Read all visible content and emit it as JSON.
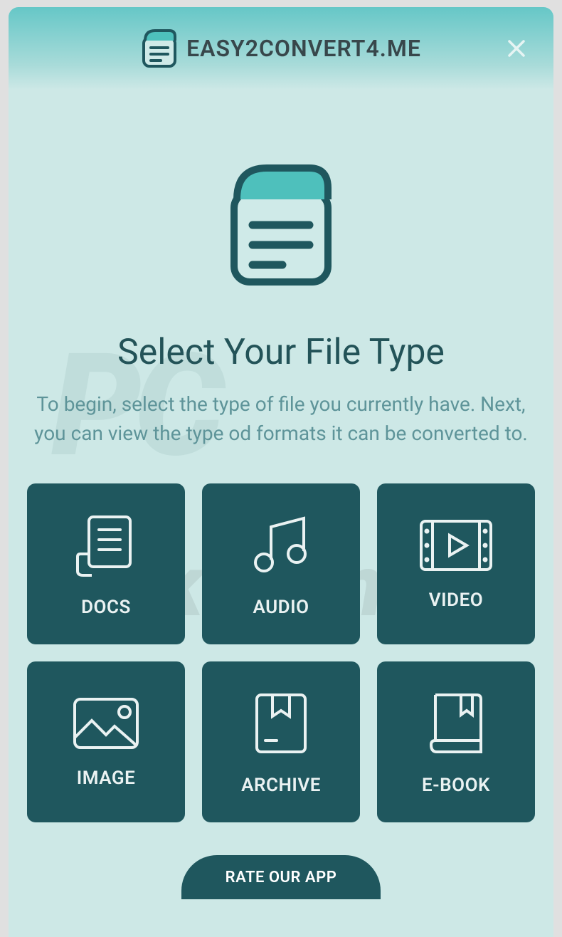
{
  "header": {
    "title": "EASY2CONVERT4.ME"
  },
  "main": {
    "title": "Select Your File Type",
    "subtitle": "To begin, select the type of file you currently have. Next, you can view the type od formats it can be converted to."
  },
  "tiles": [
    {
      "label": "DOCS"
    },
    {
      "label": "AUDIO"
    },
    {
      "label": "VIDEO"
    },
    {
      "label": "IMAGE"
    },
    {
      "label": "ARCHIVE"
    },
    {
      "label": "E-BOOK"
    }
  ],
  "footer": {
    "rate_label": "RATE OUR APP"
  }
}
